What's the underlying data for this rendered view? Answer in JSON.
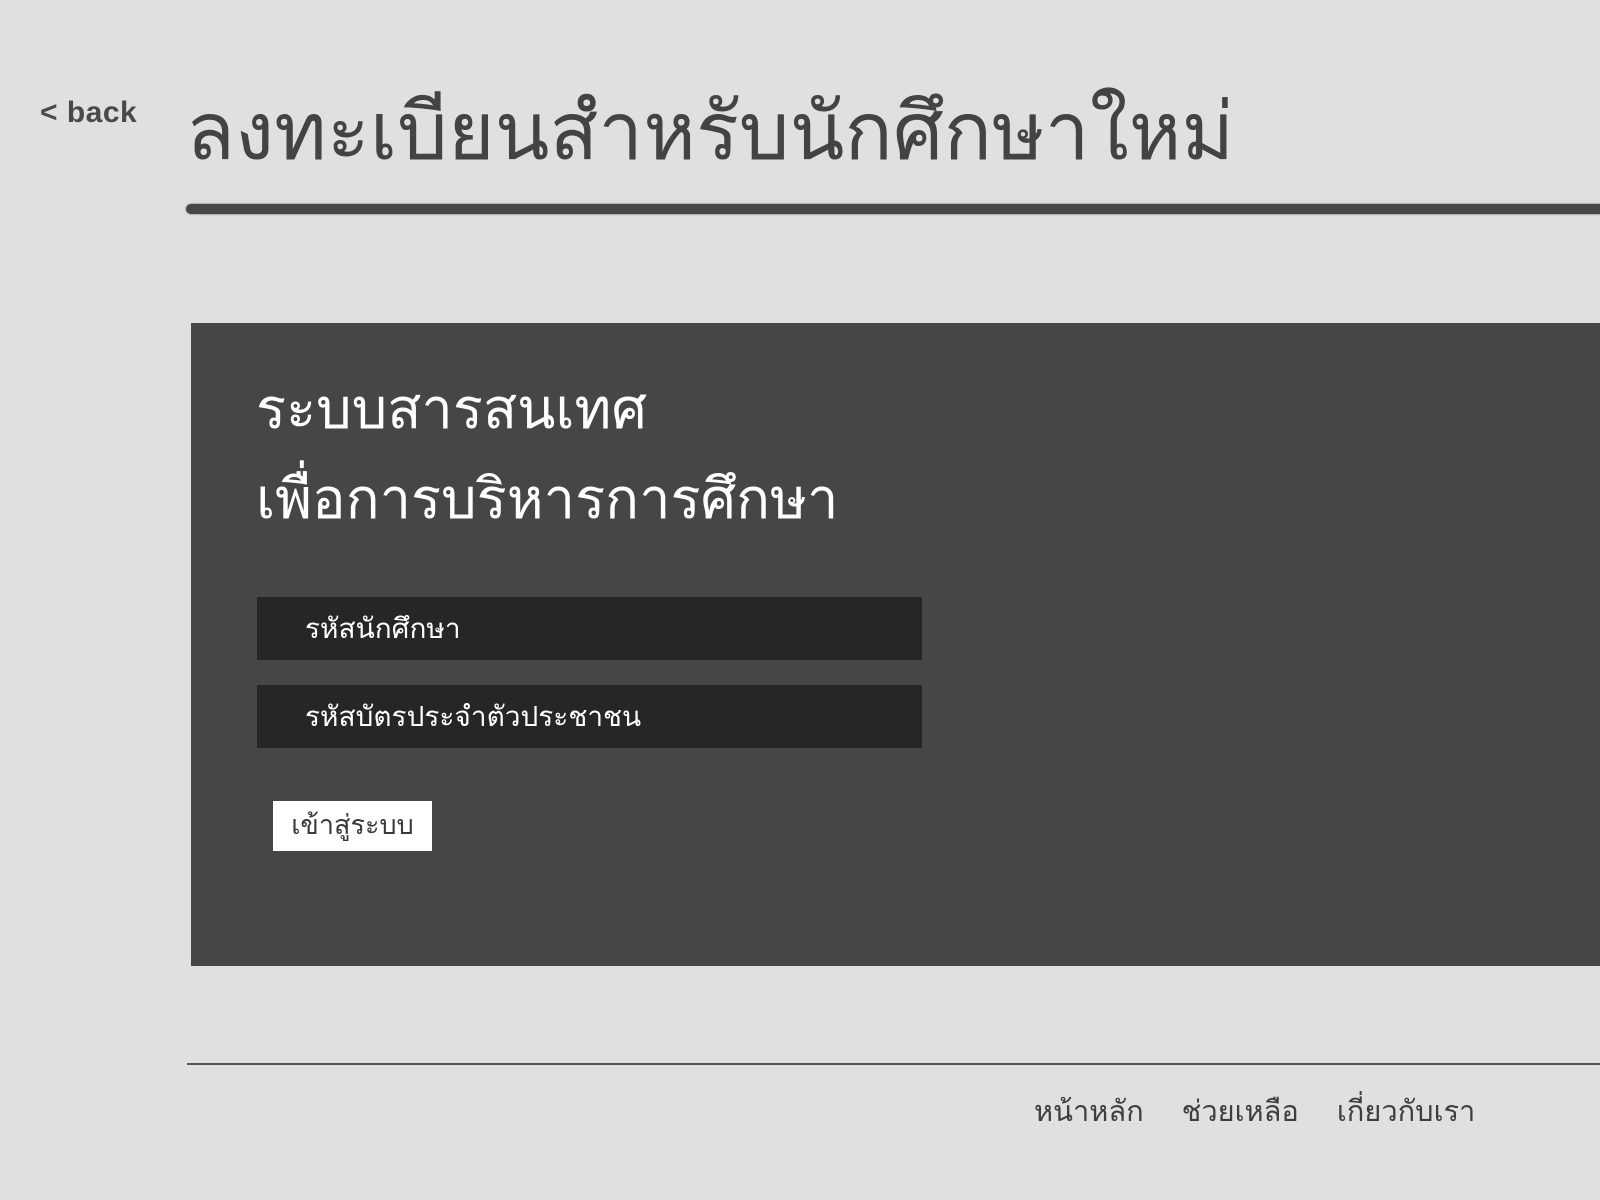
{
  "nav": {
    "back_label": "< back"
  },
  "header": {
    "title": "ลงทะเบียนสำหรับนักศึกษาใหม่"
  },
  "login_panel": {
    "system_title_line1": "ระบบสารสนเทศ",
    "system_title_line2": "เพื่อการบริหารการศึกษา",
    "student_id_placeholder": "รหัสนักศึกษา",
    "citizen_id_placeholder": "รหัสบัตรประจำตัวประชาชน",
    "login_label": "เข้าสู่ระบบ"
  },
  "footer": {
    "links": [
      {
        "label": "หน้าหลัก"
      },
      {
        "label": "ช่วยเหลือ"
      },
      {
        "label": "เกี่ยวกับเรา"
      }
    ]
  },
  "colors": {
    "background": "#e0e0e0",
    "panel": "#464646",
    "field": "#262626",
    "button": "#ffffff",
    "title_text": "#434343"
  }
}
